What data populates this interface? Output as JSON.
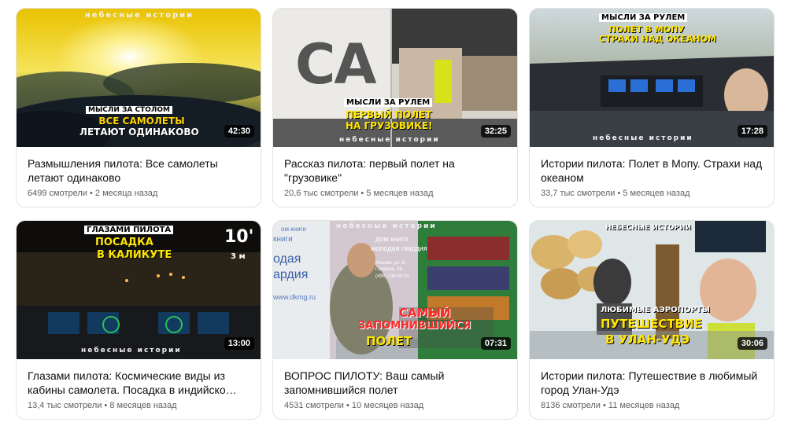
{
  "videos": [
    {
      "title": "Размышления пилота: Все самолеты летают одинаково",
      "duration": "42:30",
      "meta": "6499 смотрели • 2 месяца назад",
      "overlay": {
        "channel": "небесные истории",
        "badge": "МЫСЛИ ЗА СТОЛОМ",
        "line1": "ВСЕ САМОЛЕТЫ",
        "line2": "ЛЕТАЮТ ОДИНАКОВО"
      }
    },
    {
      "title": "Рассказ пилота: первый полет на \"грузовике\"",
      "duration": "32:25",
      "meta": "20,6 тыс смотрели • 5 месяцев назад",
      "overlay": {
        "channel": "небесные истории",
        "badge": "МЫСЛИ ЗА РУЛЕМ",
        "line1": "ПЕРВЫЙ ПОЛЕТ",
        "line2": "НА ГРУЗОВИКЕ!",
        "big": "CA"
      }
    },
    {
      "title": "Истории пилота: Полет в Мопу. Страхи над океаном",
      "duration": "17:28",
      "meta": "33,7 тыс смотрели • 5 месяцев назад",
      "overlay": {
        "channel": "небесные истории",
        "badge": "МЫСЛИ ЗА РУЛЕМ",
        "line1": "ПОЛЕТ В МОПУ",
        "line2": "СТРАХИ НАД ОКЕАНОМ"
      }
    },
    {
      "title": "Глазами пилота: Космические виды из кабины самолета. Посадка в индийско…",
      "duration": "13:00",
      "meta": "13,4 тыс смотрели • 8 месяцев назад",
      "overlay": {
        "channel": "небесные истории",
        "badge": "ГЛАЗАМИ ПИЛОТА",
        "line1": "ПОСАДКА",
        "line2": "В КАЛИКУТЕ",
        "big": "10'",
        "small": "3 м"
      }
    },
    {
      "title": "ВОПРОС ПИЛОТУ: Ваш самый запомнившийся полет",
      "duration": "07:31",
      "meta": "4531 смотрели • 10 месяцев назад",
      "overlay": {
        "channel": "небесные истории",
        "line1": "САМЫЙ",
        "line2": "ЗАПОМНИВШИЙСЯ",
        "line3": "ПОЛЕТ",
        "sign1": "дом книги",
        "sign2": "молодая гвардия",
        "sign3": "Москва, ул. Б. Полянка, 28",
        "sign4": "(495) 238-50-01",
        "sign5": "www.dkmg.ru",
        "sign6": "книги",
        "sign7": "одая",
        "sign8": "ардия",
        "sign9": "ом книги"
      }
    },
    {
      "title": "Истории пилота: Путешествие в любимый город Улан-Удэ",
      "duration": "30:06",
      "meta": "8136 смотрели • 11 месяцев назад",
      "overlay": {
        "channel": "НЕБЕСНЫЕ ИСТОРИИ",
        "badge": "ЛЮБИМЫЕ АЭРОПОРТЫ",
        "line1": "ПУТЕШЕСТВИЕ",
        "line2": "В УЛАН-УДЭ"
      }
    }
  ]
}
